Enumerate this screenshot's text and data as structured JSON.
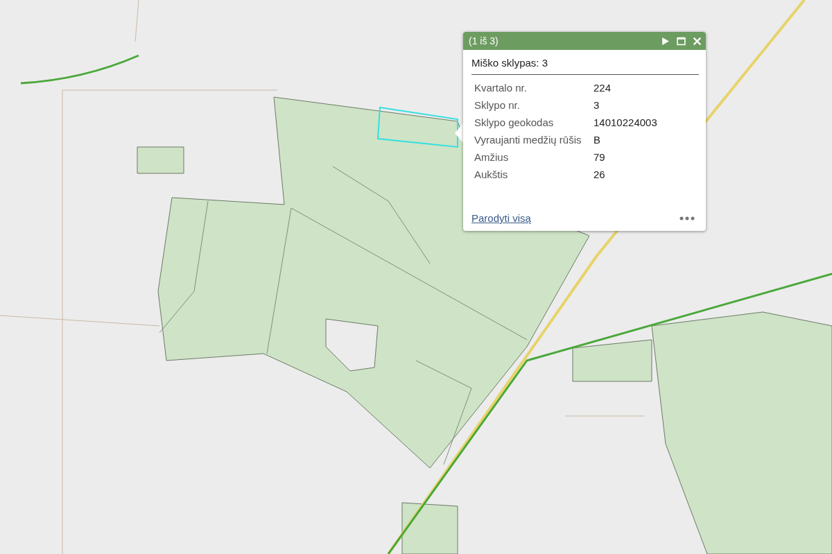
{
  "popup": {
    "counter": "(1 iš 3)",
    "title": "Miško sklypas: 3",
    "fields": [
      {
        "label": "Kvartalo nr.",
        "value": "224"
      },
      {
        "label": "Sklypo nr.",
        "value": "3"
      },
      {
        "label": "Sklypo geokodas",
        "value": "14010224003"
      },
      {
        "label": "Vyraujanti medžių rūšis",
        "value": "B"
      },
      {
        "label": "Amžius",
        "value": "79"
      },
      {
        "label": "Aukštis",
        "value": "26"
      }
    ],
    "link": "Parodyti visą"
  }
}
